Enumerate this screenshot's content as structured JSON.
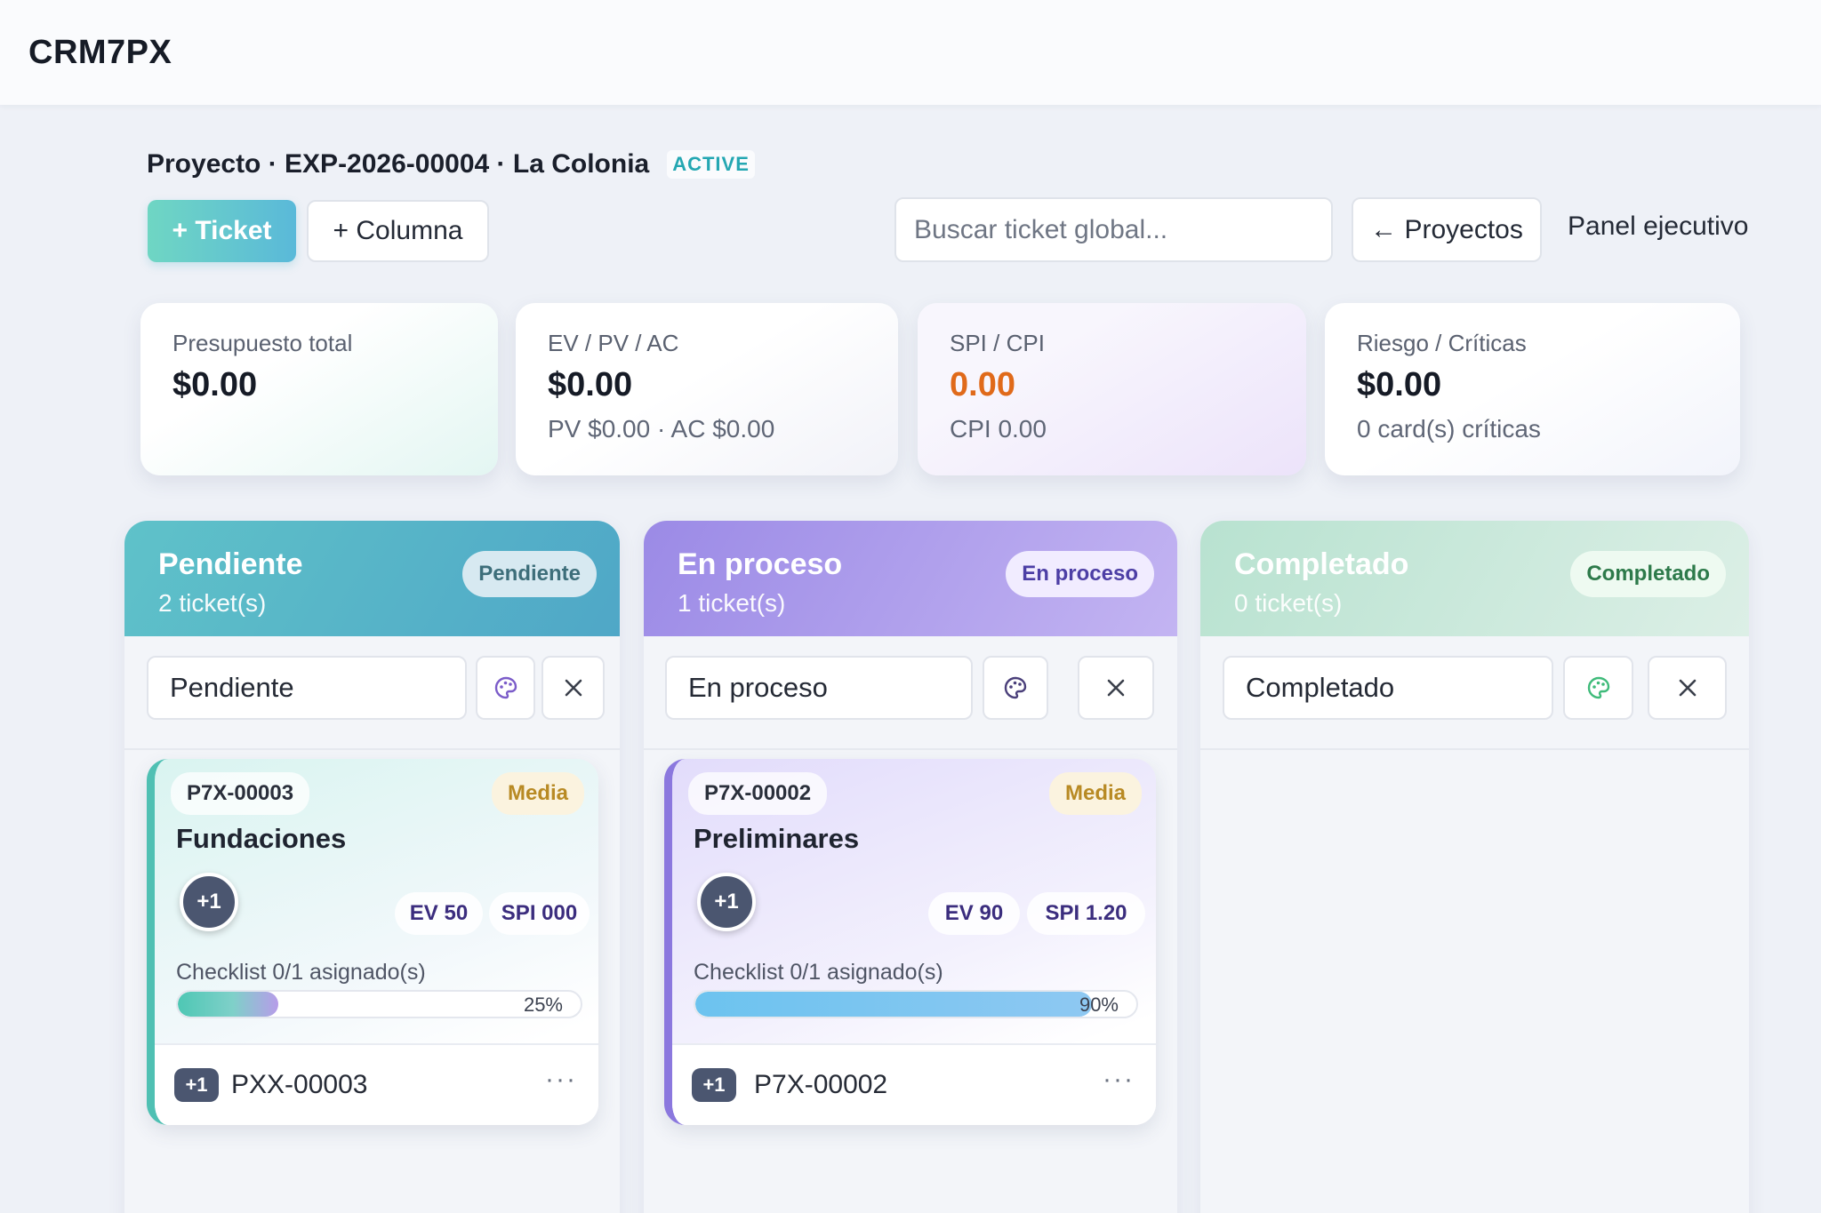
{
  "app": {
    "brand": "CRM7PX"
  },
  "project": {
    "title": "Proyecto · EXP-2026-00004 · La Colonia",
    "status": "ACTIVE"
  },
  "toolbar": {
    "ticket_label": "+ Ticket",
    "column_label": "+ Columna",
    "search_placeholder": "Buscar ticket global...",
    "projects_label": "← Proyectos",
    "panel_label": "Panel ejecutivo"
  },
  "kpis": [
    {
      "label": "Presupuesto total",
      "value": "$0.00",
      "sub": ""
    },
    {
      "label": "EV / PV / AC",
      "value": "$0.00",
      "sub": "PV $0.00 · AC $0.00"
    },
    {
      "label": "SPI / CPI",
      "value": "0.00",
      "sub": "CPI 0.00"
    },
    {
      "label": "Riesgo / Críticas",
      "value": "$0.00",
      "sub": "0 card(s) críticas"
    }
  ],
  "colors": {
    "accent_teal": "#4fc0b3",
    "accent_purple": "#8b78de",
    "accent_green": "#b8e2d0",
    "spi_value": "#e06a1a"
  },
  "columns": [
    {
      "title": "Pendiente",
      "count": "2 ticket(s)",
      "pill": "Pendiente",
      "name_value": "Pendiente",
      "icons": {
        "palette": "palette-icon",
        "close": "close-icon"
      },
      "cards": [
        {
          "id": "P7X-00003",
          "priority": "Media",
          "title": "Fundaciones",
          "avatar": "+1",
          "ev": "EV 50",
          "spi": "SPI 000",
          "checklist": "Checklist 0/1 asignado(s)",
          "progress": 0.25,
          "progress_label": "25%",
          "foot_badge": "+1",
          "foot_id": "PXX-00003",
          "more": "···"
        }
      ]
    },
    {
      "title": "En proceso",
      "count": "1 ticket(s)",
      "pill": "En proceso",
      "name_value": "En proceso",
      "icons": {
        "palette": "palette-icon",
        "close": "close-icon"
      },
      "cards": [
        {
          "id": "P7X-00002",
          "priority": "Media",
          "title": "Preliminares",
          "avatar": "+1",
          "ev": "EV 90",
          "spi": "SPI 1.20",
          "checklist": "Checklist 0/1 asignado(s)",
          "progress": 0.9,
          "progress_label": "90%",
          "foot_badge": "+1",
          "foot_id": "P7X-00002",
          "more": "···"
        }
      ]
    },
    {
      "title": "Completado",
      "count": "0 ticket(s)",
      "pill": "Completado",
      "name_value": "Completado",
      "icons": {
        "palette": "palette-icon",
        "close": "close-icon"
      },
      "cards": []
    }
  ]
}
